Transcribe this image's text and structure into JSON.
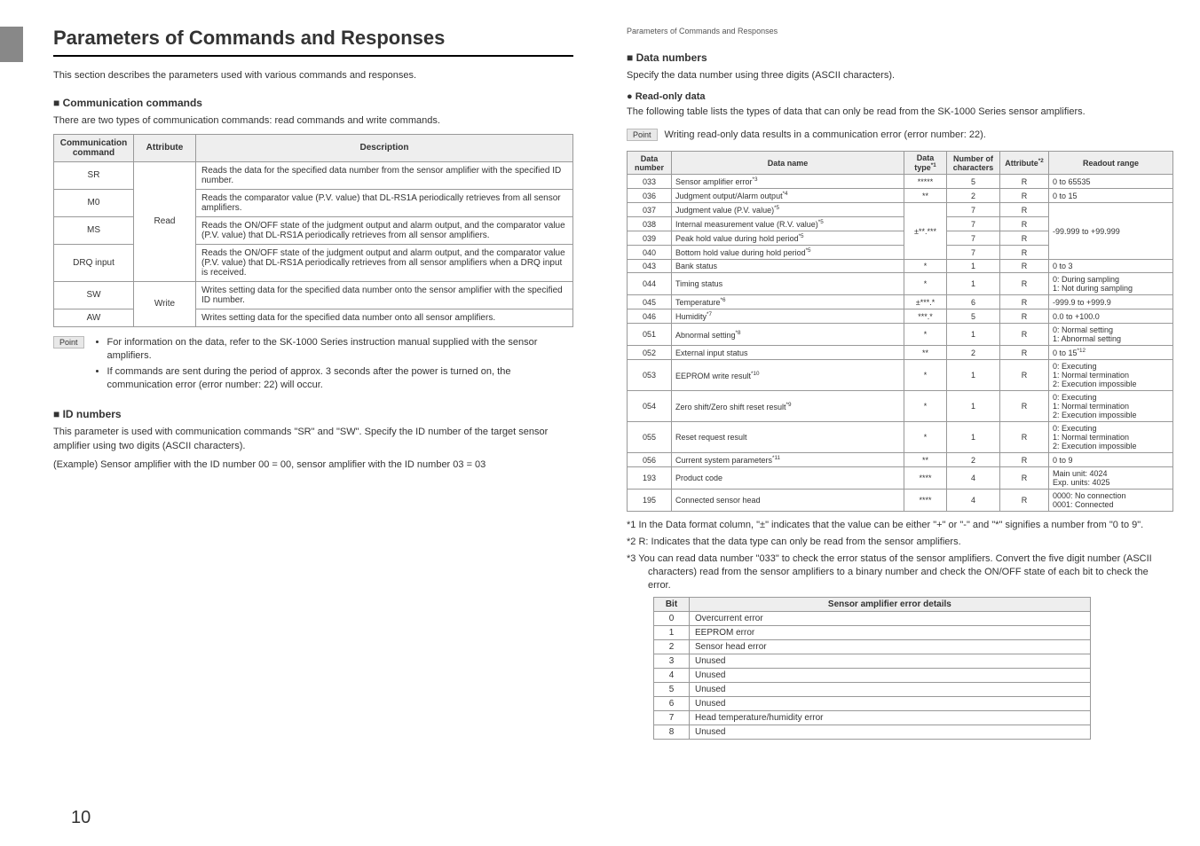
{
  "left": {
    "chapter_title": "Parameters of Commands and Responses",
    "intro": "This section describes the parameters used with various commands and responses.",
    "sec_comm": "Communication commands",
    "comm_intro": "There are two types of communication commands: read commands and write commands.",
    "cmd_headers": {
      "c1": "Communication command",
      "c2": "Attribute",
      "c3": "Description"
    },
    "cmd_rows": {
      "sr": "SR",
      "sr_d": "Reads the data for the specified data number from the sensor amplifier with the specified ID number.",
      "m0": "M0",
      "m0_d": "Reads the comparator value (P.V. value) that DL-RS1A periodically retrieves from all sensor amplifiers.",
      "ms": "MS",
      "ms_d": "Reads the ON/OFF state of the judgment output and alarm output, and the comparator value (P.V. value) that DL-RS1A periodically retrieves from all sensor amplifiers.",
      "drq": "DRQ input",
      "drq_d": "Reads the ON/OFF state of the judgment output and alarm output, and the comparator value (P.V. value) that DL-RS1A periodically retrieves from all sensor amplifiers when a DRQ input is received.",
      "sw": "SW",
      "sw_d": "Writes setting data for the specified data number onto the sensor amplifier with the specified ID number.",
      "aw": "AW",
      "aw_d": "Writes setting data for the specified data number onto all sensor amplifiers.",
      "attr_read": "Read",
      "attr_write": "Write"
    },
    "point": "Point",
    "point_items": {
      "p1": "For information on the data, refer to the SK-1000 Series instruction manual supplied with the sensor amplifiers.",
      "p2": "If commands are sent during the period of approx. 3 seconds after the power is turned on, the communication error (error number: 22) will occur."
    },
    "sec_id": "ID numbers",
    "id_p1": "This parameter is used with communication commands \"SR\" and \"SW\". Specify the ID number of the target sensor amplifier using two digits (ASCII characters).",
    "id_p2": "(Example) Sensor amplifier with the ID number 00 = 00, sensor amplifier with the ID number 03 = 03",
    "page_num": "10"
  },
  "right": {
    "breadcrumb": "Parameters of Commands and Responses",
    "sec_data": "Data numbers",
    "data_intro": "Specify the data number using three digits (ASCII characters).",
    "sub_read": "Read-only data",
    "ro_intro": "The following table lists the types of data that can only be read from the SK-1000 Series sensor amplifiers.",
    "point_text": "Writing read-only data results in a communication error (error number: 22).",
    "ro_headers": {
      "h1": "Data number",
      "h2": "Data name",
      "h3": "Data type",
      "h3sup": "*1",
      "h4": "Number of characters",
      "h5": "Attribute",
      "h5sup": "*2",
      "h6": "Readout range"
    },
    "rows": [
      {
        "num": "033",
        "name": "Sensor amplifier error",
        "name_sup": "*3",
        "type": "*****",
        "chars": "5",
        "attr": "R",
        "range": "0 to 65535"
      },
      {
        "num": "036",
        "name": "Judgment output/Alarm output",
        "name_sup": "*4",
        "type": "**",
        "chars": "2",
        "attr": "R",
        "range": "0 to 15"
      },
      {
        "num": "037",
        "name": "Judgment value (P.V. value)",
        "name_sup": "*5",
        "type": "±**.***",
        "chars": "7",
        "attr": "R",
        "range_merge_start": true
      },
      {
        "num": "038",
        "name": "Internal measurement value (R.V. value)",
        "name_sup": "*5",
        "type": "",
        "chars": "7",
        "attr": "R"
      },
      {
        "num": "039",
        "name": "Peak hold value during hold period",
        "name_sup": "*5",
        "type": "",
        "chars": "7",
        "attr": "R"
      },
      {
        "num": "040",
        "name": "Bottom hold value during hold period",
        "name_sup": "*5",
        "type": "",
        "chars": "7",
        "attr": "R",
        "range_merge_text": "-99.999 to +99.999"
      },
      {
        "num": "043",
        "name": "Bank status",
        "type": "*",
        "chars": "1",
        "attr": "R",
        "range": "0 to 3"
      },
      {
        "num": "044",
        "name": "Timing status",
        "type": "*",
        "chars": "1",
        "attr": "R",
        "range": "0: During sampling\n1: Not during sampling"
      },
      {
        "num": "045",
        "name": "Temperature",
        "name_sup": "*6",
        "type": "±***.*",
        "chars": "6",
        "attr": "R",
        "range": "-999.9 to +999.9"
      },
      {
        "num": "046",
        "name": "Humidity",
        "name_sup": "*7",
        "type": "***.*",
        "chars": "5",
        "attr": "R",
        "range": "0.0 to +100.0"
      },
      {
        "num": "051",
        "name": "Abnormal setting",
        "name_sup": "*8",
        "type": "*",
        "chars": "1",
        "attr": "R",
        "range": "0: Normal setting\n1: Abnormal setting"
      },
      {
        "num": "052",
        "name": "External input status",
        "type": "**",
        "chars": "2",
        "attr": "R",
        "range": "0 to 15",
        "range_sup": "*12"
      },
      {
        "num": "053",
        "name": "EEPROM write result",
        "name_sup": "*10",
        "type": "*",
        "chars": "1",
        "attr": "R",
        "range": "0: Executing\n1: Normal termination\n2: Execution impossible"
      },
      {
        "num": "054",
        "name": "Zero shift/Zero shift reset result",
        "name_sup": "*9",
        "type": "*",
        "chars": "1",
        "attr": "R",
        "range": "0: Executing\n1: Normal termination\n2: Execution impossible"
      },
      {
        "num": "055",
        "name": "Reset request result",
        "type": "*",
        "chars": "1",
        "attr": "R",
        "range": "0: Executing\n1: Normal termination\n2: Execution impossible"
      },
      {
        "num": "056",
        "name": "Current system parameters",
        "name_sup": "*11",
        "type": "**",
        "chars": "2",
        "attr": "R",
        "range": "0 to 9"
      },
      {
        "num": "193",
        "name": "Product code",
        "type": "****",
        "chars": "4",
        "attr": "R",
        "range": "Main unit: 4024\nExp. units: 4025"
      },
      {
        "num": "195",
        "name": "Connected sensor head",
        "type": "****",
        "chars": "4",
        "attr": "R",
        "range": "0000: No connection\n0001: Connected"
      }
    ],
    "notes": {
      "n1": "*1    In the Data format column, \"±\" indicates that the value can be either \"+\" or \"-\" and \"*\" signifies a number from \"0 to 9\".",
      "n2": "*2    R: Indicates that the data type can only be read from the sensor amplifiers.",
      "n3": "*3    You can read data number \"033\" to check the error status of the sensor amplifiers. Convert the five digit number (ASCII characters) read from the sensor amplifiers to a binary number and check the ON/OFF state of each bit to check the error."
    },
    "bits_headers": {
      "b1": "Bit",
      "b2": "Sensor amplifier error details"
    },
    "bits": [
      {
        "n": "0",
        "d": "Overcurrent error"
      },
      {
        "n": "1",
        "d": "EEPROM error"
      },
      {
        "n": "2",
        "d": "Sensor head error"
      },
      {
        "n": "3",
        "d": "Unused"
      },
      {
        "n": "4",
        "d": "Unused"
      },
      {
        "n": "5",
        "d": "Unused"
      },
      {
        "n": "6",
        "d": "Unused"
      },
      {
        "n": "7",
        "d": "Head temperature/humidity error"
      },
      {
        "n": "8",
        "d": "Unused"
      }
    ]
  }
}
